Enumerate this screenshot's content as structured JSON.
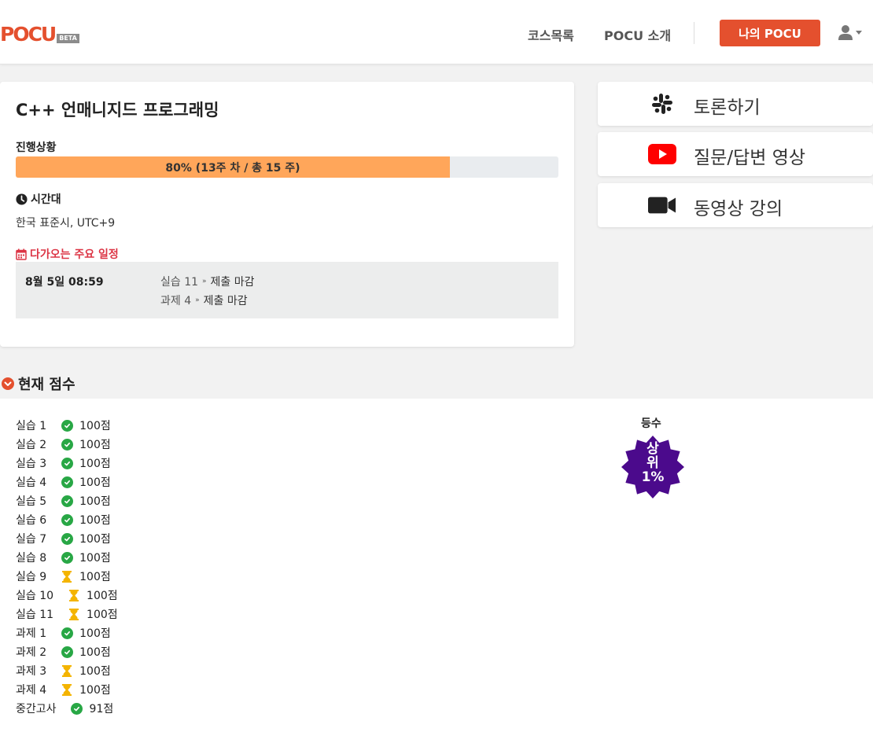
{
  "header": {
    "logo_text": "POCU",
    "logo_badge": "BETA",
    "nav": [
      "코스목록",
      "POCU 소개"
    ],
    "my_button": "나의 POCU",
    "user_icon": "user-icon",
    "accent_color": "#e4502e"
  },
  "course": {
    "title": "C++ 언매니지드 프로그래밍",
    "progress_label": "진행상황",
    "progress_percent": 80,
    "progress_text": "80% (13주 차 / 총 15 주)",
    "progress_color": "#ffa65a",
    "timezone_label": "시간대",
    "timezone_value": "한국 표준시, UTC+9",
    "upcoming_label": "다가오는 주요 일정",
    "schedule": {
      "date": "8월 5일 08:59",
      "items": [
        {
          "name": "실습 11",
          "status": "제출 마감"
        },
        {
          "name": "과제 4",
          "status": "제출 마감"
        }
      ]
    }
  },
  "side_links": [
    {
      "label": "토론하기",
      "icon": "slack-icon"
    },
    {
      "label": "질문/답변 영상",
      "icon": "youtube-icon"
    },
    {
      "label": "동영상 강의",
      "icon": "video-camera-icon"
    }
  ],
  "scores": {
    "section_title": "현재 점수",
    "rows": [
      {
        "name": "실습 1",
        "status": "done",
        "score": "100점"
      },
      {
        "name": "실습 2",
        "status": "done",
        "score": "100점"
      },
      {
        "name": "실습 3",
        "status": "done",
        "score": "100점"
      },
      {
        "name": "실습 4",
        "status": "done",
        "score": "100점"
      },
      {
        "name": "실습 5",
        "status": "done",
        "score": "100점"
      },
      {
        "name": "실습 6",
        "status": "done",
        "score": "100점"
      },
      {
        "name": "실습 7",
        "status": "done",
        "score": "100점"
      },
      {
        "name": "실습 8",
        "status": "done",
        "score": "100점"
      },
      {
        "name": "실습 9",
        "status": "pending",
        "score": "100점"
      },
      {
        "name": "실습 10",
        "status": "pending",
        "score": "100점"
      },
      {
        "name": "실습 11",
        "status": "pending",
        "score": "100점"
      },
      {
        "name": "과제 1",
        "status": "done",
        "score": "100점"
      },
      {
        "name": "과제 2",
        "status": "done",
        "score": "100점"
      },
      {
        "name": "과제 3",
        "status": "pending",
        "score": "100점"
      },
      {
        "name": "과제 4",
        "status": "pending",
        "score": "100점"
      },
      {
        "name": "중간고사",
        "status": "done",
        "score": "91점"
      }
    ],
    "rank_label": "등수",
    "rank_badge_lines": [
      "상",
      "위",
      "1%"
    ],
    "rank_color": "#4b0a8c"
  }
}
